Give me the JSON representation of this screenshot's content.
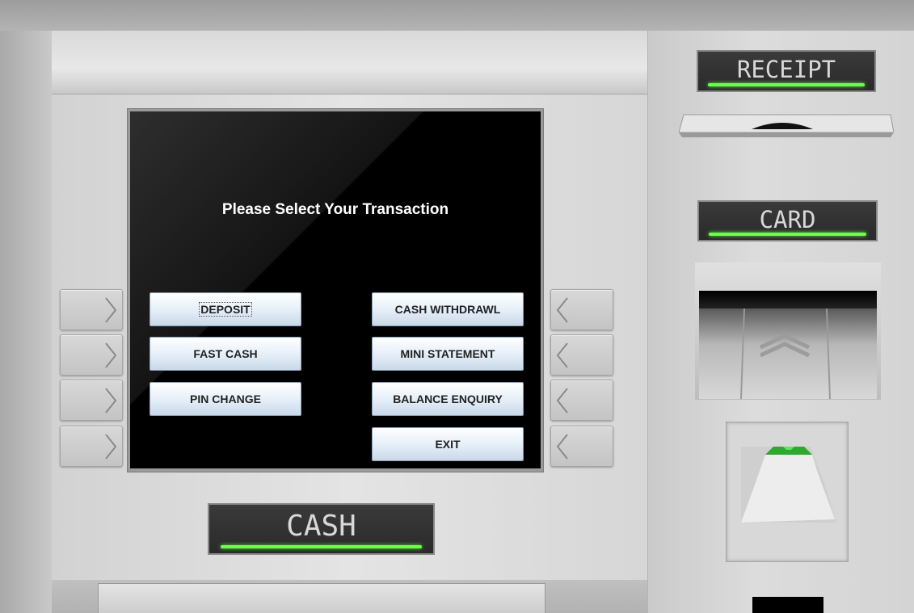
{
  "screen": {
    "title": "Please Select Your Transaction",
    "buttons_left": [
      {
        "label": "DEPOSIT"
      },
      {
        "label": "FAST CASH"
      },
      {
        "label": "PIN CHANGE"
      }
    ],
    "buttons_right": [
      {
        "label": "CASH WITHDRAWL"
      },
      {
        "label": "MINI STATEMENT"
      },
      {
        "label": "BALANCE ENQUIRY"
      },
      {
        "label": "EXIT"
      }
    ]
  },
  "labels": {
    "receipt": "RECEIPT",
    "card": "CARD",
    "cash": "CASH"
  },
  "colors": {
    "glow": "#6aff4a",
    "screen_bg": "#000000",
    "button_text": "#222222"
  },
  "icons": {
    "left_keys": "chevron-right-icon",
    "right_keys": "chevron-left-icon",
    "card_slot": "chevron-up-icon",
    "card_insert": "card-insert-icon"
  }
}
